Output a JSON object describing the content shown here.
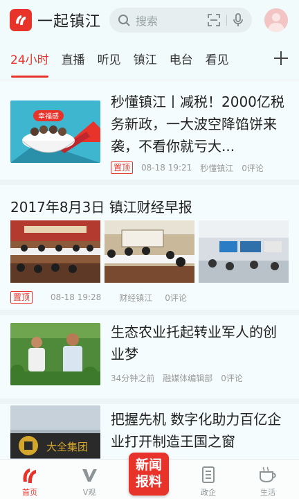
{
  "header": {
    "app_title": "一起镇江",
    "search_placeholder": "搜索"
  },
  "tabs": [
    {
      "label": "24小时",
      "active": true
    },
    {
      "label": "直播"
    },
    {
      "label": "听见"
    },
    {
      "label": "镇江"
    },
    {
      "label": "电台"
    },
    {
      "label": "看见"
    }
  ],
  "tab_add_icon": "plus-icon",
  "feed": {
    "item1": {
      "title": "秒懂镇江丨减税！2000亿税务新政，一大波空降馅饼来袭，不看你就亏大...",
      "badge": "置顶",
      "time": "08-18 19:21",
      "source": "秒懂镇江",
      "comments": "0评论",
      "thumb_text": "幸福感"
    },
    "item2": {
      "title": "2017年8月3日 镇江财经早报",
      "badge": "置顶",
      "time": "08-18 19:28",
      "source": "财经镇江",
      "comments": "0评论"
    },
    "item3": {
      "title": "生态农业托起转业军人的创业梦",
      "time": "34分钟之前",
      "source": "融媒体编辑部",
      "comments": "0评论"
    },
    "item4": {
      "title": "把握先机 数字化助力百亿企业打开制造王国之窗",
      "thumb_text": "大全集团"
    }
  },
  "bottom_nav": [
    {
      "label": "首页",
      "icon": "home-logo-icon",
      "active": true
    },
    {
      "label": "V观",
      "icon": "v-icon"
    },
    {
      "label": "新闻报料",
      "icon": "report-icon"
    },
    {
      "label": "政企",
      "icon": "building-icon"
    },
    {
      "label": "生活",
      "icon": "cup-icon"
    }
  ],
  "colors": {
    "accent": "#e8332b",
    "header_bg": "#f2fbfc",
    "feed_bg": "#f5fcfd"
  }
}
